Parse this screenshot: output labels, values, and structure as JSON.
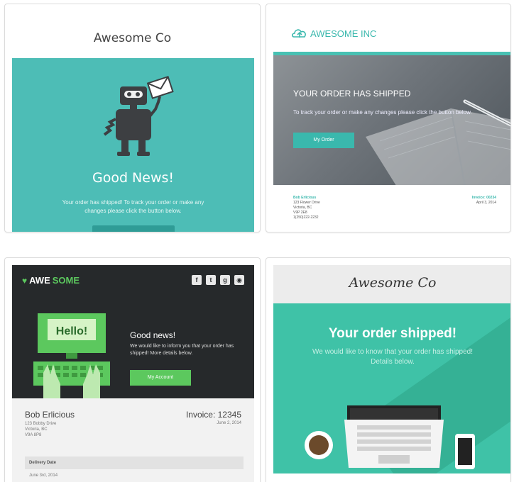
{
  "card1": {
    "brand": "Awesome Co",
    "headline": "Good News!",
    "body": "Your order has shipped! To track your order or make any changes please click the button below.",
    "colors": {
      "hero": "#4dbdb6",
      "button": "#2f9c96"
    },
    "illustration": "robot-icon"
  },
  "card2": {
    "logo_text": "AWESOME INC",
    "headline": "YOUR ORDER HAS SHIPPED",
    "sub": "To track your order or make any changes please click the button below.",
    "button": "My Order",
    "address": {
      "name": "Bob Erlicious",
      "lines": [
        "123 Flower Drive",
        "Victoria, BC",
        "V9P 2E8",
        "1(250)222-2232"
      ]
    },
    "invoice": {
      "label": "Invoice: 00234",
      "date": "April 3, 2014"
    },
    "colors": {
      "accent": "#3ab8ad"
    }
  },
  "card3": {
    "logo_a": "AWE",
    "logo_b": "SOME",
    "social": [
      "facebook-icon",
      "twitter-icon",
      "google-plus-icon",
      "instagram-icon"
    ],
    "monitor_text": "Hello!",
    "headline": "Good news!",
    "body": "We would like to inform you that your order has shipped! More details below.",
    "button": "My Account",
    "customer": {
      "name": "Bob Erlicious",
      "lines": [
        "123 Bobby Drive",
        "Victoria, BC",
        "V9A 8P8"
      ]
    },
    "invoice": {
      "label": "Invoice: 12345",
      "date": "June 2, 2014"
    },
    "delivery": {
      "header": "Delivery Date",
      "value": "June 3rd, 2014"
    },
    "colors": {
      "accent": "#5cc85e",
      "dark": "#26292b"
    }
  },
  "card4": {
    "brand": "Awesome Co",
    "headline": "Your order shipped!",
    "sub": "We would like to know that your order has shipped! Details below.",
    "colors": {
      "hero": "#3fc2a7"
    }
  }
}
